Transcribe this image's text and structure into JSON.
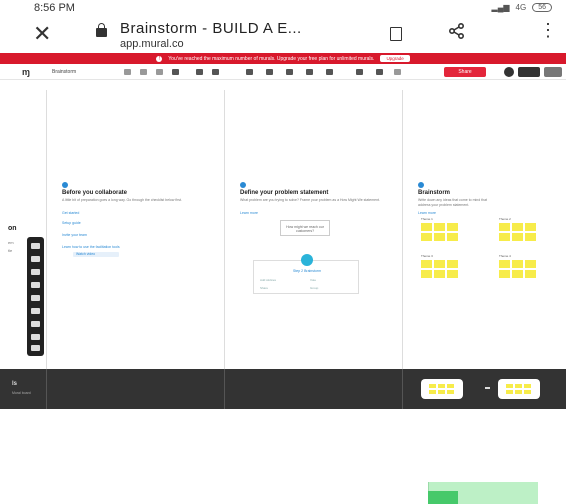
{
  "status_bar": {
    "time": "8:56 PM",
    "signal_text": "4G",
    "battery": "56"
  },
  "browser": {
    "title": "Brainstorm - BUILD A E...",
    "url": "app.mural.co"
  },
  "banner": {
    "message": "You've reached the maximum number of murals. Upgrade your free plan for unlimited murals.",
    "upgrade_label": "Upgrade"
  },
  "toolbar": {
    "logo": "ɱ",
    "mural_name": "Brainstorm",
    "share_label": "Share"
  },
  "sidebar_peek": {
    "heading": "on",
    "line1": "em",
    "line2": "tle"
  },
  "panels": [
    {
      "title": "Before you collaborate",
      "body": "A little bit of preparation goes a long way. Go through the checklist below first.",
      "link": "Get started",
      "items": [
        "Setup guide",
        "Invite your team",
        "Learn how to use the facilitation tools"
      ],
      "button_label": "Watch video"
    },
    {
      "title": "Define your problem statement",
      "body": "What problem are you trying to solve? Frame your problem as a How Might We statement.",
      "link": "Learn more",
      "card_text": "How might we reach our customers?",
      "callout_title": "Step 2 Brainstorm",
      "callout_items": [
        "Add stickies",
        "Vote",
        "Share",
        "Group"
      ]
    },
    {
      "title": "Brainstorm",
      "body": "Write down any ideas that come to mind that address your problem statement.",
      "link": "Learn more",
      "groups": [
        "Theme 1",
        "Theme 2",
        "Theme 3",
        "Theme 4"
      ]
    }
  ],
  "bottom_strip": {
    "outline_title": "ls",
    "outline_sub": "Mural board"
  },
  "colors": {
    "brand_red": "#d8192c",
    "sticky_yellow": "#f7ec4a",
    "accent_blue": "#2a8ad4",
    "dark_strip": "#333333"
  },
  "icons": {
    "close": "close-icon",
    "lock": "lock-icon",
    "bookmark": "bookmark-icon",
    "share": "share-icon",
    "more": "more-vertical-icon"
  }
}
